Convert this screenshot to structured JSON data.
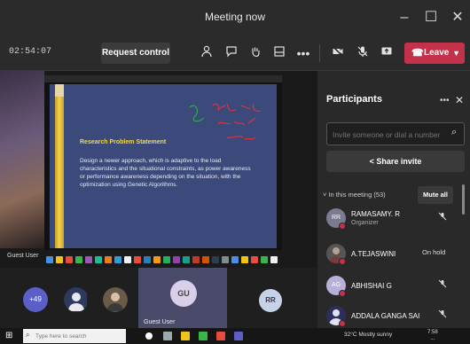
{
  "window": {
    "title": "Meeting now",
    "minimize_icon": "minimize-icon",
    "maximize_icon": "maximize-icon",
    "close_icon": "close-icon"
  },
  "toolbar": {
    "timer": "02:54:07",
    "request_control": "Request control",
    "icons": [
      "people-icon",
      "chat-icon",
      "raise-hand-icon",
      "rooms-icon",
      "more-icon",
      "camera-off-icon",
      "mic-off-icon",
      "share-icon"
    ],
    "leave_label": "Leave",
    "leave_color": "#c4314b"
  },
  "shared_screen": {
    "slide_title": "Research Problem Statement",
    "slide_body": "Design a newer approach, which is adaptive to the load characteristics and the situational constraints, as power awareness or performance awareness depending on the situation, with the optimization using Genetic Algorithms.",
    "presenter_label": "Guest User"
  },
  "participants": {
    "title": "Participants",
    "invite_placeholder": "Invite someone or dial a number",
    "share_invite": "Share invite",
    "section_label": "In this meeting (53)",
    "mute_all": "Mute all",
    "people": [
      {
        "initials": "RR",
        "name": "RAMASAMY. R",
        "role": "Organizer",
        "status": "mic-off-icon"
      },
      {
        "initials": "",
        "name": "A.TEJASWINI",
        "role": "",
        "status": "On hold"
      },
      {
        "initials": "AG",
        "name": "ABHISHAI G",
        "role": "",
        "status": "mic-off-icon"
      },
      {
        "initials": "",
        "name": "ADDALA GANGA SAI",
        "role": "",
        "status": "mic-off-icon"
      }
    ]
  },
  "gallery": {
    "more_count": "+49",
    "self_initials": "GU",
    "self_label": "Guest User",
    "rr_initials": "RR"
  },
  "taskbar": {
    "search_placeholder": "Type here to search",
    "tray_text": "32°C Mostly sunny",
    "time": "7:58",
    "date": "..."
  }
}
